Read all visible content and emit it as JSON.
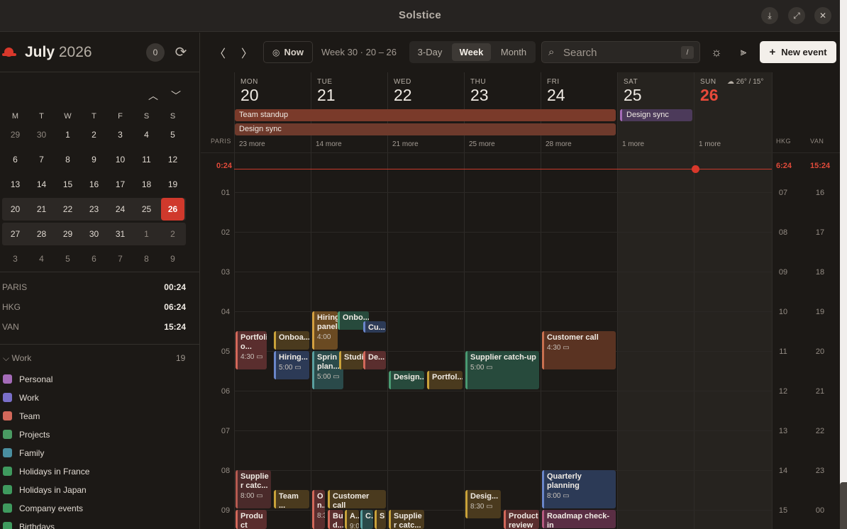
{
  "window": {
    "title": "Solstice"
  },
  "sidebar": {
    "month": "July",
    "year": "2026",
    "badge": "0",
    "weekdays": [
      "M",
      "T",
      "W",
      "T",
      "F",
      "S",
      "S"
    ],
    "weeks": [
      [
        "29",
        "30",
        "1",
        "2",
        "3",
        "4",
        "5"
      ],
      [
        "6",
        "7",
        "8",
        "9",
        "10",
        "11",
        "12"
      ],
      [
        "13",
        "14",
        "15",
        "16",
        "17",
        "18",
        "19"
      ],
      [
        "20",
        "21",
        "22",
        "23",
        "24",
        "25",
        "26"
      ],
      [
        "27",
        "28",
        "29",
        "30",
        "31",
        "1",
        "2"
      ],
      [
        "3",
        "4",
        "5",
        "6",
        "7",
        "8",
        "9"
      ]
    ],
    "timezones": [
      {
        "name": "PARIS",
        "time": "00:24"
      },
      {
        "name": "HKG",
        "time": "06:24"
      },
      {
        "name": "VAN",
        "time": "15:24"
      }
    ],
    "group": {
      "name": "Work",
      "count": "19"
    },
    "calendars": [
      {
        "name": "Personal",
        "color": "#a46bb8"
      },
      {
        "name": "Work",
        "color": "#7a6fc9"
      },
      {
        "name": "Team",
        "color": "#d2685a"
      },
      {
        "name": "Projects",
        "color": "#4a9a62"
      },
      {
        "name": "Family",
        "color": "#4a8fa0"
      },
      {
        "name": "Holidays in France",
        "color": "#3f9a5e"
      },
      {
        "name": "Holidays in Japan",
        "color": "#3f9a5e"
      },
      {
        "name": "Company events",
        "color": "#3f9a5e"
      },
      {
        "name": "Birthdays",
        "color": "#3f9a5e"
      }
    ]
  },
  "toolbar": {
    "now_label": "Now",
    "week_label": "Week 30 · 20 – 26",
    "views": [
      "3-Day",
      "Week",
      "Month"
    ],
    "active_view": "Week",
    "search_placeholder": "Search",
    "search_shortcut": "/",
    "new_event_label": "New event"
  },
  "grid": {
    "days": [
      {
        "name": "MON",
        "date": "20",
        "more": "23 more"
      },
      {
        "name": "TUE",
        "date": "21",
        "more": "14 more"
      },
      {
        "name": "WED",
        "date": "22",
        "more": "21 more"
      },
      {
        "name": "THU",
        "date": "23",
        "more": "25 more"
      },
      {
        "name": "FRI",
        "date": "24",
        "more": "28 more"
      },
      {
        "name": "SAT",
        "date": "25",
        "more": "1 more"
      },
      {
        "name": "SUN",
        "date": "26",
        "more": "1 more"
      }
    ],
    "weather": "26° / 15°",
    "allday": [
      {
        "title": "Team standup",
        "color": "#7a3a2a"
      },
      {
        "title": "Design sync",
        "color": "#6e3a2c"
      },
      {
        "title": "Design sync",
        "color": "#4c3a5a"
      }
    ],
    "tz_left": "PARIS",
    "tz_right": [
      "HKG",
      "VAN"
    ],
    "now": {
      "paris": "0:24",
      "hkg": "6:24",
      "van": "15:24"
    },
    "hours_paris": [
      "01",
      "02",
      "03",
      "04",
      "05",
      "06",
      "07",
      "08",
      "09"
    ],
    "hours_hkg": [
      "07",
      "08",
      "09",
      "10",
      "11",
      "12",
      "13",
      "14",
      "15"
    ],
    "hours_van": [
      "16",
      "17",
      "18",
      "19",
      "20",
      "21",
      "22",
      "23",
      "00"
    ],
    "events": [
      {
        "title": "Portfoli o...",
        "time": "4:30"
      },
      {
        "title": "Onboa..."
      },
      {
        "title": "Hiring...",
        "time": "5:00"
      },
      {
        "title": "Hiring panel",
        "time": "4:00"
      },
      {
        "title": "Onbo..."
      },
      {
        "title": "Cu..."
      },
      {
        "title": "Sprin plan...",
        "time": "5:00"
      },
      {
        "title": "Studi..."
      },
      {
        "title": "De..."
      },
      {
        "title": "Design..."
      },
      {
        "title": "Portfol..."
      },
      {
        "title": "Supplier catch-up",
        "time": "5:00"
      },
      {
        "title": "Customer call",
        "time": "4:30"
      },
      {
        "title": "Supplie r catc...",
        "time": "8:00"
      },
      {
        "title": "Team ..."
      },
      {
        "title": "O n...",
        "time": "8:3"
      },
      {
        "title": "Customer call"
      },
      {
        "title": "Desig...",
        "time": "8:30"
      },
      {
        "title": "Quarterly planning",
        "time": "8:00"
      },
      {
        "title": "Produ ct"
      },
      {
        "title": "Bu d..."
      },
      {
        "title": "A...",
        "time": "9:0"
      },
      {
        "title": "C..."
      },
      {
        "title": "S"
      },
      {
        "title": "Supplie r catc..."
      },
      {
        "title": "Product review"
      },
      {
        "title": "Roadmap check-in"
      }
    ]
  }
}
